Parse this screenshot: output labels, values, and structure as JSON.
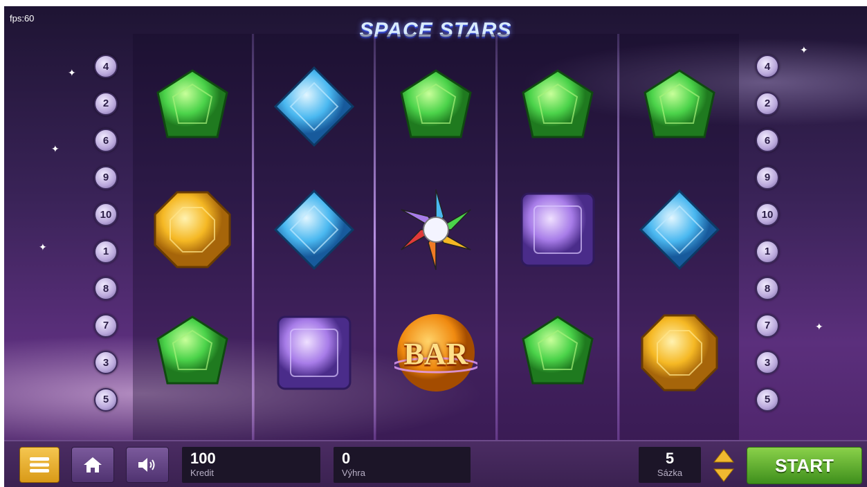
{
  "fps": "fps:60",
  "title": "SPACE STARS",
  "paylines_left": [
    "4",
    "2",
    "6",
    "9",
    "10",
    "1",
    "8",
    "7",
    "3",
    "5"
  ],
  "paylines_right": [
    "4",
    "2",
    "6",
    "9",
    "10",
    "1",
    "8",
    "7",
    "3",
    "5"
  ],
  "reels": [
    [
      "green-gem",
      "yellow-gem",
      "green-gem"
    ],
    [
      "blue-gem",
      "blue-gem",
      "purple-gem"
    ],
    [
      "green-gem",
      "star-wild",
      "bar"
    ],
    [
      "green-gem",
      "purple-gem",
      "green-gem"
    ],
    [
      "green-gem",
      "blue-gem",
      "yellow-gem"
    ]
  ],
  "bar_symbol_text": "BAR",
  "credit": {
    "value": "100",
    "label": "Kredit"
  },
  "win": {
    "value": "0",
    "label": "Výhra"
  },
  "bet": {
    "value": "5",
    "label": "Sázka"
  },
  "start_label": "START",
  "colors": {
    "green": "#4bd34a",
    "blue": "#4ab8f0",
    "purple": "#a77ce8",
    "yellow": "#f5b824",
    "start": "#5bb02c"
  }
}
